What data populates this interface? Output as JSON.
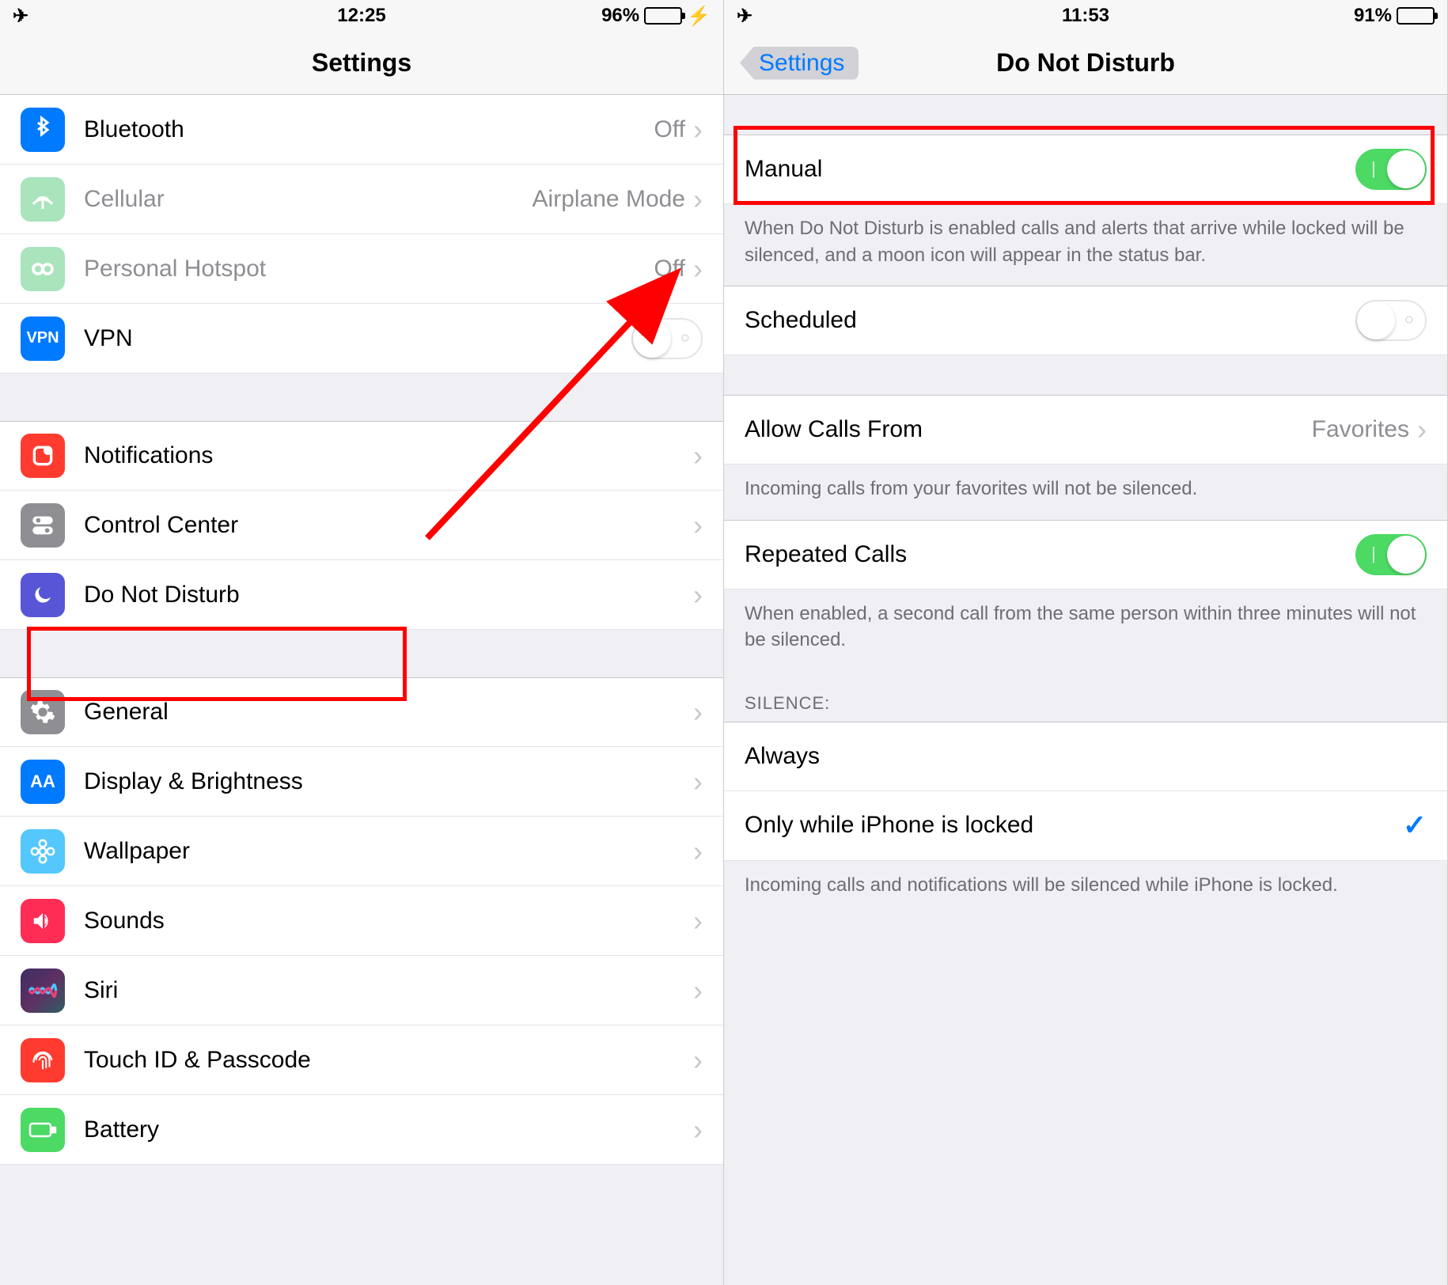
{
  "left": {
    "status": {
      "time": "12:25",
      "battery_pct": "96%",
      "charging": true
    },
    "nav_title": "Settings",
    "rows": {
      "bluetooth": {
        "label": "Bluetooth",
        "value": "Off"
      },
      "cellular": {
        "label": "Cellular",
        "value": "Airplane Mode"
      },
      "hotspot": {
        "label": "Personal Hotspot",
        "value": "Off"
      },
      "vpn": {
        "label": "VPN",
        "icon_text": "VPN"
      },
      "notifications": {
        "label": "Notifications"
      },
      "control_center": {
        "label": "Control Center"
      },
      "dnd": {
        "label": "Do Not Disturb"
      },
      "general": {
        "label": "General"
      },
      "display": {
        "label": "Display & Brightness",
        "icon_text": "AA"
      },
      "wallpaper": {
        "label": "Wallpaper"
      },
      "sounds": {
        "label": "Sounds"
      },
      "siri": {
        "label": "Siri"
      },
      "touchid": {
        "label": "Touch ID & Passcode"
      },
      "battery": {
        "label": "Battery"
      }
    }
  },
  "right": {
    "status": {
      "time": "11:53",
      "battery_pct": "91%"
    },
    "nav_back": "Settings",
    "nav_title": "Do Not Disturb",
    "manual": {
      "label": "Manual",
      "on": true
    },
    "manual_footer": "When Do Not Disturb is enabled calls and alerts that arrive while locked will be silenced, and a moon icon will appear in the status bar.",
    "scheduled": {
      "label": "Scheduled",
      "on": false
    },
    "allow_calls": {
      "label": "Allow Calls From",
      "value": "Favorites"
    },
    "allow_calls_footer": "Incoming calls from your favorites will not be silenced.",
    "repeated": {
      "label": "Repeated Calls",
      "on": true
    },
    "repeated_footer": "When enabled, a second call from the same person within three minutes will not be silenced.",
    "silence_header": "SILENCE:",
    "silence_always": "Always",
    "silence_locked": "Only while iPhone is locked",
    "silence_footer": "Incoming calls and notifications will be silenced while iPhone is locked."
  }
}
